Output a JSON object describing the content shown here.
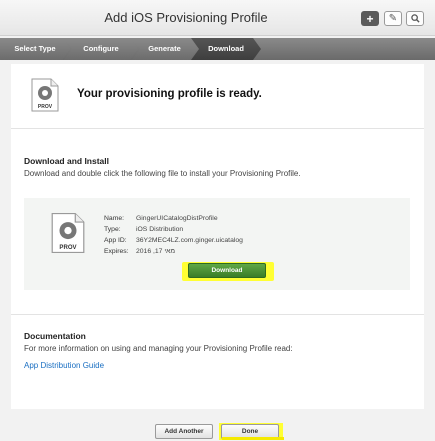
{
  "window": {
    "title": "Add iOS Provisioning Profile"
  },
  "toolbar": {
    "add_icon": "plus-icon",
    "edit_icon": "pencil-icon",
    "search_icon": "search-icon"
  },
  "steps": [
    "Select Type",
    "Configure",
    "Generate",
    "Download"
  ],
  "ready": {
    "icon_label": "PROV",
    "message": "Your provisioning profile is ready."
  },
  "download_section": {
    "title": "Download and Install",
    "description": "Download and double click the following file to install your Provisioning Profile.",
    "file": {
      "icon_label": "PROV",
      "rows": [
        {
          "label": "Name:",
          "value": "GingerUICatalogDistProfile"
        },
        {
          "label": "Type:",
          "value": "iOS Distribution"
        },
        {
          "label": "App ID:",
          "value": "36Y2MEC4LZ.com.ginger.uicatalog"
        },
        {
          "label": "Expires:",
          "value": "2016 ,17 מאי"
        }
      ]
    },
    "download_label": "Download"
  },
  "documentation": {
    "title": "Documentation",
    "description": "For more information on using and managing your Provisioning Profile read:",
    "link": "App Distribution Guide"
  },
  "footer": {
    "add_another": "Add Another",
    "done": "Done"
  },
  "colors": {
    "download_green": "#3a7d28",
    "highlight": "#ffff33",
    "link": "#1a6fc2"
  }
}
